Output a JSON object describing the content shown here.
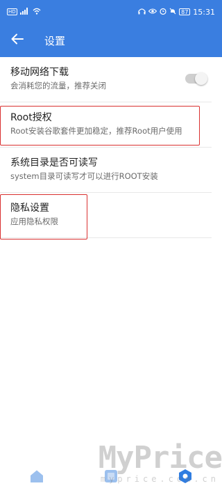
{
  "status_bar": {
    "hd": "HD",
    "battery": "87",
    "time": "15:31"
  },
  "app_bar": {
    "title": "设置"
  },
  "settings": [
    {
      "title": "移动网络下载",
      "subtitle": "会消耗您的流量，推荐关闭",
      "toggle_on": false
    },
    {
      "title": "Root授权",
      "subtitle": "Root安装谷歌套件更加稳定，推荐Root用户使用"
    },
    {
      "title": "系统目录是否可读写",
      "subtitle": "system目录可读写才可以进行ROOT安装"
    },
    {
      "title": "隐私设置",
      "subtitle": "应用隐私权限"
    }
  ],
  "bottom_nav": {
    "items": [
      "home-icon",
      "apps-icon",
      "settings-icon"
    ],
    "active_color": "#2f7de1",
    "inactive_color": "#9cc0ee"
  },
  "watermark": {
    "main": "MyPrice",
    "sub": "myprice.com.cn"
  },
  "colors": {
    "primary": "#3a7ee0",
    "highlight_box": "#d9302f"
  }
}
